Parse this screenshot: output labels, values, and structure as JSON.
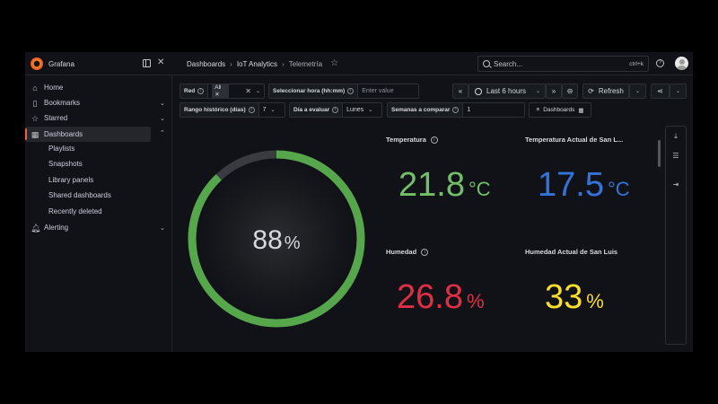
{
  "app": {
    "brand": "Grafana"
  },
  "breadcrumbs": [
    "Dashboards",
    "IoT Analytics",
    "Telemetría"
  ],
  "search": {
    "placeholder": "Search...",
    "shortcut": "ctrl+k"
  },
  "sidebar": {
    "items": [
      {
        "label": "Home",
        "icon": "home-icon"
      },
      {
        "label": "Bookmarks",
        "icon": "bookmark-icon"
      },
      {
        "label": "Starred",
        "icon": "star-icon"
      },
      {
        "label": "Dashboards",
        "icon": "apps-icon"
      },
      {
        "label": "Alerting",
        "icon": "bell-icon"
      }
    ],
    "sub_items": [
      "Playlists",
      "Snapshots",
      "Library panels",
      "Shared dashboards",
      "Recently deleted"
    ]
  },
  "variables": {
    "red": {
      "label": "Red",
      "value": "All"
    },
    "hora": {
      "label": "Seleccionar hora (hh:mm)",
      "placeholder": "Enter value"
    },
    "rango": {
      "label": "Rango histórico (días)",
      "value": "7"
    },
    "dia": {
      "label": "Día a evaluar",
      "value": "Lunes"
    },
    "semanas": {
      "label": "Semanas a comparar",
      "value": "1"
    },
    "dashboards_link": "Dashboards"
  },
  "toolbar": {
    "time_range": "Last 6 hours",
    "refresh": "Refresh"
  },
  "panels": {
    "gauge": {
      "value": 88,
      "unit": "%",
      "fraction": 0.88,
      "color": "#56a64b",
      "track": "#3a3b40"
    },
    "temperatura": {
      "title": "Temperatura",
      "value": "21.8",
      "unit": "°C",
      "color": "#73bf69"
    },
    "temp_san_luis": {
      "title": "Temperatura Actual de San L...",
      "value": "17.5",
      "unit": "°C",
      "color": "#3274d9"
    },
    "humedad": {
      "title": "Humedad",
      "value": "26.8",
      "unit": "%",
      "color": "#e02f44"
    },
    "hum_san_luis": {
      "title": "Humedad Actual de San Luis",
      "value": "33",
      "unit": "%",
      "color": "#fade2a"
    }
  }
}
